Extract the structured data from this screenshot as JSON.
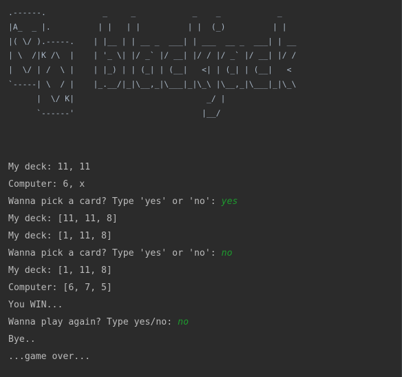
{
  "logo": {
    "ascii_art": ".------.            _     _            _    _            _\n|A_  _ |.          | |   | |          | |  (_)          | |\n|( \\/ ).-----.    | |__ | | __ _  ___| | ___  __ _  ___| | __\n| \\  /|K /\\  |    | '_ \\| |/ _` |/ __| |/ / |/ _` |/ __| |/ /\n|  \\/ | /  \\ |    | |_) | | (_| | (__|   <| | (_| | (__|   <\n`-----| \\  / |    |_.__/|_|\\__,_|\\___|_|\\_\\ |\\__,_|\\___|_|\\_\\\n      |  \\/ K|                            _/ |\n      `------'                           |__/"
  },
  "output": {
    "lines": [
      {
        "text": "My deck: 11, 11",
        "input": ""
      },
      {
        "text": "Computer: 6, x",
        "input": ""
      },
      {
        "text": "Wanna pick a card? Type 'yes' or 'no': ",
        "input": "yes"
      },
      {
        "text": "My deck: [11, 11, 8]",
        "input": ""
      },
      {
        "text": "My deck: [1, 11, 8]",
        "input": ""
      },
      {
        "text": "Wanna pick a card? Type 'yes' or 'no': ",
        "input": "no"
      },
      {
        "text": "My deck: [1, 11, 8]",
        "input": ""
      },
      {
        "text": "Computer: [6, 7, 5]",
        "input": ""
      },
      {
        "text": "You WIN...",
        "input": ""
      },
      {
        "text": "Wanna play again? Type yes/no: ",
        "input": "no"
      },
      {
        "text": "Bye..",
        "input": ""
      },
      {
        "text": "...game over...",
        "input": ""
      }
    ]
  },
  "colors": {
    "background": "#2b2b2b",
    "text": "#bbbbbb",
    "user_input": "#1e9a2e"
  }
}
